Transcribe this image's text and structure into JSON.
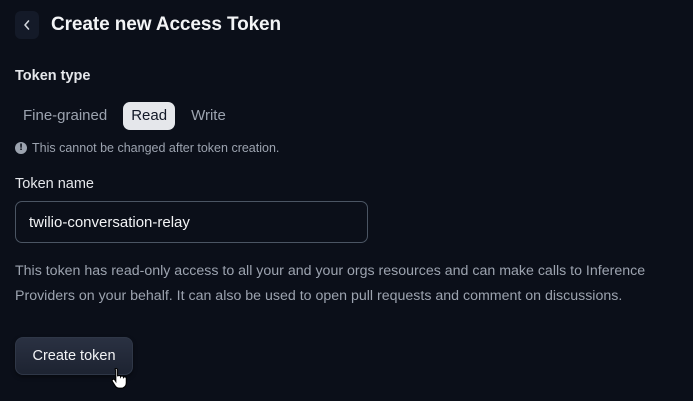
{
  "header": {
    "back_icon": "chevron-left-icon",
    "title": "Create new Access Token"
  },
  "token_type": {
    "label": "Token type",
    "options": [
      {
        "label": "Fine-grained",
        "selected": false
      },
      {
        "label": "Read",
        "selected": true
      },
      {
        "label": "Write",
        "selected": false
      }
    ],
    "note_icon": "info-icon",
    "note": "This cannot be changed after token creation."
  },
  "token_name": {
    "label": "Token name",
    "value": "twilio-conversation-relay"
  },
  "description": "This token has read-only access to all your and your orgs resources and can make calls to Inference Providers on your behalf. It can also be used to open pull requests and comment on discussions.",
  "create_button": {
    "label": "Create token"
  },
  "colors": {
    "background": "#0b0f19",
    "active_segment": "#e5e7eb",
    "muted_text": "#9ca3af"
  }
}
